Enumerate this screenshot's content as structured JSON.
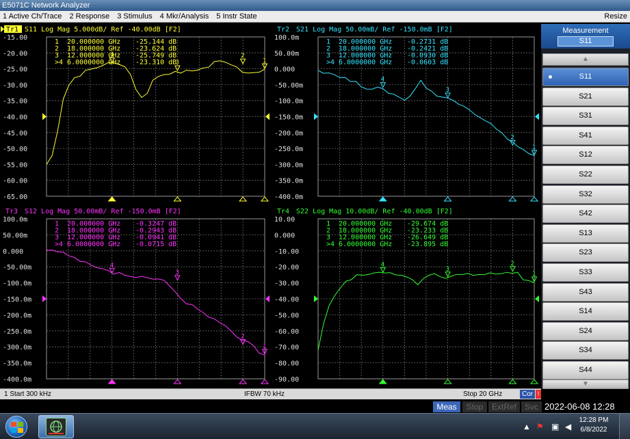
{
  "window": {
    "title": "E5071C Network Analyzer"
  },
  "menu": {
    "items": [
      "1 Active Ch/Trace",
      "2 Response",
      "3 Stimulus",
      "4 Mkr/Analysis",
      "5 Instr State"
    ],
    "resize": "Resize"
  },
  "charts": [
    {
      "id": "tr1",
      "trace_label": "Tr1",
      "header": "S11 Log Mag 5.000dB/ Ref -40.00dB [F2]",
      "color": "#ffff33",
      "highlight": true,
      "y_ticks": [
        "-15.00",
        "-20.00",
        "-25.00",
        "-30.00",
        "-35.00",
        "-40.00",
        "-45.00",
        "-50.00",
        "-55.00",
        "-60.00",
        "-65.00"
      ],
      "ref_index": 5,
      "markers": [
        [
          "1",
          "20.000000 GHz",
          "-25.144 dB"
        ],
        [
          "2",
          "18.000000 GHz",
          "-23.624 dB"
        ],
        [
          "3",
          "12.000000 GHz",
          "-25.749 dB"
        ],
        [
          ">4",
          "6.0000000 GHz",
          "-23.310 dB"
        ]
      ],
      "trace": [
        -55,
        -52,
        -44,
        -35,
        -30,
        -28,
        -27,
        -26,
        -25,
        -24.5,
        -24,
        -23.6,
        -23.4,
        -23.5,
        -24.5,
        -27,
        -31,
        -34.5,
        -33,
        -29,
        -27,
        -26.5,
        -26.5,
        -26.2,
        -26.5,
        -25.8,
        -25.5,
        -25.2,
        -25,
        -24,
        -23,
        -22.5,
        -23,
        -23.5,
        -24.5,
        -25.5,
        -26.2,
        -26,
        -25.5,
        -25.1
      ],
      "marker_frac": [
        1.0,
        0.9,
        0.6,
        0.3
      ],
      "marker_vals": [
        -25.144,
        -23.624,
        -25.749,
        -23.31
      ]
    },
    {
      "id": "tr2",
      "trace_label": "Tr2",
      "header": "S21 Log Mag 50.00mB/ Ref -150.0mB [F2]",
      "color": "#33e5ff",
      "highlight": false,
      "y_ticks": [
        "100.0m",
        "50.00m",
        "0.000",
        "-50.00m",
        "-100.0m",
        "-150.0m",
        "-200.0m",
        "-250.0m",
        "-300.0m",
        "-350.0m",
        "-400.0m"
      ],
      "ref_index": 5,
      "markers": [
        [
          "1",
          "20.000000 GHz",
          "-0.2731 dB"
        ],
        [
          "2",
          "18.000000 GHz",
          "-0.2421 dB"
        ],
        [
          "3",
          "12.000000 GHz",
          "-0.0930 dB"
        ],
        [
          ">4",
          "6.0000000 GHz",
          "-0.0603 dB"
        ]
      ],
      "trace": [
        -5,
        -8,
        -12,
        -18,
        -22,
        -30,
        -38,
        -45,
        -52,
        -58,
        -60,
        -62,
        -68,
        -72,
        -80,
        -90,
        -95,
        -85,
        -60,
        -40,
        -55,
        -70,
        -85,
        -92,
        -93,
        -98,
        -105,
        -112,
        -125,
        -140,
        -150,
        -160,
        -175,
        -190,
        -205,
        -215,
        -230,
        -245,
        -255,
        -265,
        -275
      ],
      "marker_frac": [
        1.0,
        0.9,
        0.6,
        0.3
      ],
      "marker_vals": [
        -273.1,
        -242.1,
        -93,
        -60.3
      ]
    },
    {
      "id": "tr3",
      "trace_label": "Tr3",
      "header": "S12 Log Mag 50.00mB/ Ref -150.0mB [F2]",
      "color": "#ff33ff",
      "highlight": false,
      "y_ticks": [
        "100.0m",
        "50.00m",
        "0.000",
        "-50.00m",
        "-100.0m",
        "-150.0m",
        "-200.0m",
        "-250.0m",
        "-300.0m",
        "-350.0m",
        "-400.0m"
      ],
      "ref_index": 5,
      "markers": [
        [
          "1",
          "20.000000 GHz",
          "-0.3247 dB"
        ],
        [
          "2",
          "18.000000 GHz",
          "-0.2943 dB"
        ],
        [
          "3",
          "12.000000 GHz",
          "-0.0941 dB"
        ],
        [
          ">4",
          "6.0000000 GHz",
          "-0.0715 dB"
        ]
      ],
      "trace": [
        2,
        0,
        -5,
        -10,
        -18,
        -25,
        -32,
        -40,
        -48,
        -55,
        -60,
        -65,
        -70,
        -72,
        -75,
        -80,
        -82,
        -85,
        -88,
        -92,
        -93,
        -95,
        -110,
        -130,
        -150,
        -160,
        -170,
        -185,
        -195,
        -205,
        -215,
        -230,
        -240,
        -255,
        -265,
        -275,
        -285,
        -300,
        -315,
        -325
      ],
      "marker_frac": [
        1.0,
        0.9,
        0.6,
        0.3
      ],
      "marker_vals": [
        -324.7,
        -294.3,
        -94.1,
        -71.5
      ]
    },
    {
      "id": "tr4",
      "trace_label": "Tr4",
      "header": "S22 Log Mag 10.00dB/ Ref -40.00dB [F2]",
      "color": "#33ff33",
      "highlight": false,
      "y_ticks": [
        "10.00",
        "0.000",
        "-10.00",
        "-20.00",
        "-30.00",
        "-40.00",
        "-50.00",
        "-60.00",
        "-70.00",
        "-80.00",
        "-90.00"
      ],
      "ref_index": 5,
      "markers": [
        [
          "1",
          "20.000000 GHz",
          "-29.674 dB"
        ],
        [
          "2",
          "18.000000 GHz",
          "-23.233 dB"
        ],
        [
          "3",
          "12.000000 GHz",
          "-26.649 dB"
        ],
        [
          ">4",
          "6.0000000 GHz",
          "-23.895 dB"
        ]
      ],
      "trace": [
        -72,
        -55,
        -45,
        -38,
        -33,
        -30,
        -28,
        -26,
        -25,
        -24.5,
        -24,
        -23.9,
        -23.8,
        -24,
        -24.5,
        -25,
        -26.5,
        -28,
        -31,
        -28,
        -26,
        -25.5,
        -26.5,
        -27.5,
        -26,
        -25,
        -24.5,
        -24,
        -24.5,
        -24.5,
        -24.2,
        -24,
        -23.8,
        -23.5,
        -23.3,
        -23.2,
        -24,
        -27,
        -29,
        -29.7
      ],
      "marker_frac": [
        1.0,
        0.9,
        0.6,
        0.3
      ],
      "marker_vals": [
        -29.674,
        -23.233,
        -26.649,
        -23.895
      ]
    }
  ],
  "softkeys": {
    "heading": "Measurement",
    "current": "S11",
    "up_arrow": "▲",
    "down_arrow": "▼",
    "items": [
      "S11",
      "S21",
      "S31",
      "S41",
      "S12",
      "S22",
      "S32",
      "S42",
      "S13",
      "S23",
      "S33",
      "S43",
      "S14",
      "S24",
      "S34",
      "S44"
    ],
    "selected_index": 0
  },
  "status": {
    "start": "1  Start 300 kHz",
    "ifbw": "IFBW 70 kHz",
    "stop": "Stop 20 GHz",
    "cor": "Cor",
    "alert": "!"
  },
  "instr": {
    "meas": "Meas",
    "stop": "Stop",
    "extref": "ExtRef",
    "svc": "Svc",
    "datetime": "2022-06-08 12:28"
  },
  "taskbar": {
    "time": "12:28 PM",
    "date": "6/8/2022"
  }
}
